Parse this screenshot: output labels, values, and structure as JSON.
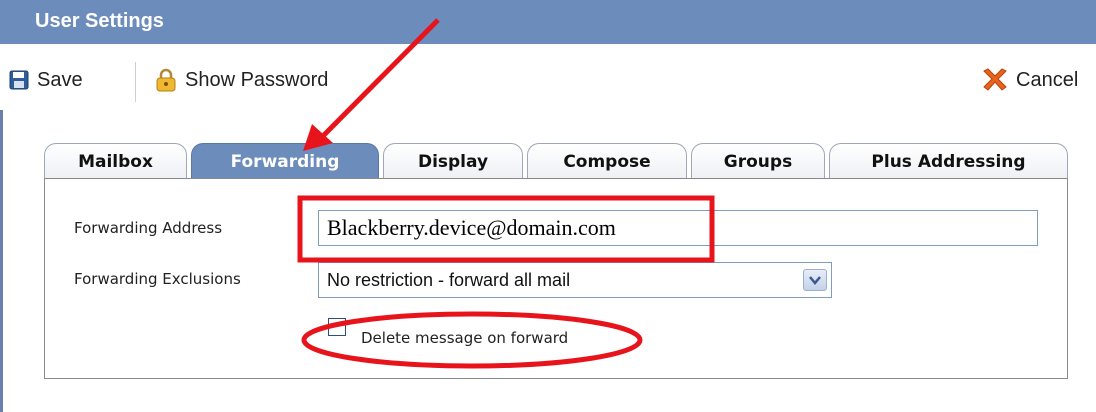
{
  "window": {
    "title": "User Settings"
  },
  "toolbar": {
    "save_label": "Save",
    "show_password_label": "Show Password",
    "cancel_label": "Cancel"
  },
  "tabs": [
    {
      "label": "Mailbox",
      "active": false
    },
    {
      "label": "Forwarding",
      "active": true
    },
    {
      "label": "Display",
      "active": false
    },
    {
      "label": "Compose",
      "active": false
    },
    {
      "label": "Groups",
      "active": false
    },
    {
      "label": "Plus Addressing",
      "active": false
    }
  ],
  "form": {
    "forwarding_address_label": "Forwarding Address",
    "forwarding_address_value": "Blackberry.device@domain.com",
    "forwarding_exclusions_label": "Forwarding Exclusions",
    "forwarding_exclusions_value": "No restriction - forward all mail",
    "delete_on_forward_label": "Delete message on forward",
    "delete_on_forward_checked": false
  },
  "annotations": {
    "color": "#e8141c"
  },
  "colors": {
    "titlebar": "#6c8cbc",
    "active_tab": "#6c8cbc",
    "accent_border": "#7f9dc0"
  },
  "icons": [
    "floppy-disk-icon",
    "lock-icon",
    "cancel-x-icon",
    "dropdown-chevron-icon"
  ]
}
